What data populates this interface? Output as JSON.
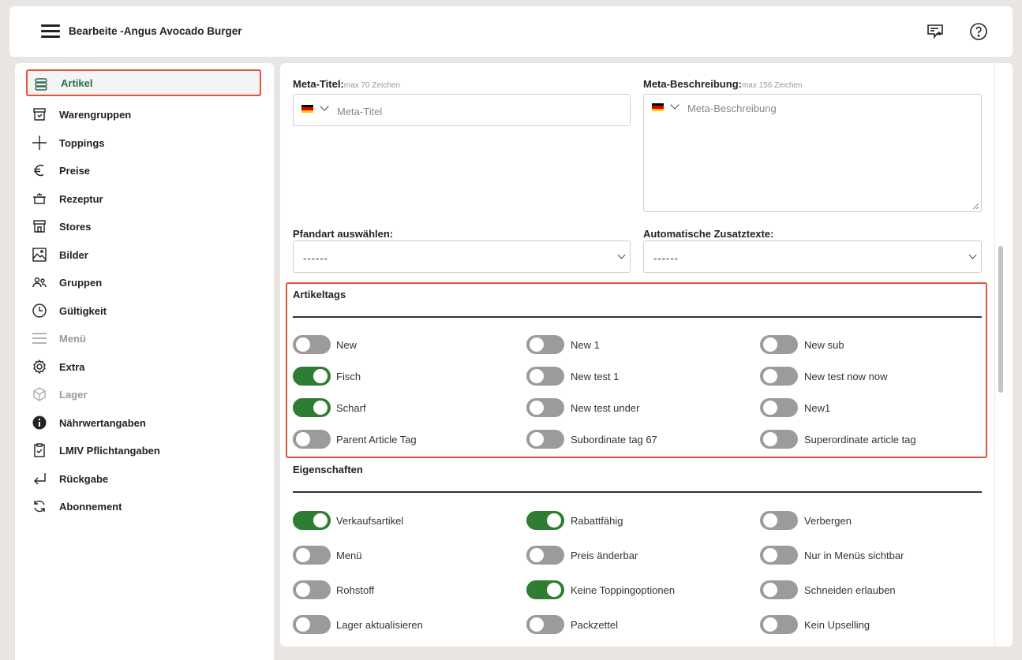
{
  "header": {
    "title": "Bearbeite -Angus Avocado Burger",
    "feedback_icon": "chat-star-icon",
    "help_icon": "help-circle-icon"
  },
  "sidebar": {
    "items": [
      {
        "label": "Artikel",
        "icon": "stack-icon",
        "state": "active"
      },
      {
        "label": "Warengruppen",
        "icon": "box-icon",
        "state": "normal"
      },
      {
        "label": "Toppings",
        "icon": "plus-icon",
        "state": "normal"
      },
      {
        "label": "Preise",
        "icon": "euro-icon",
        "state": "normal"
      },
      {
        "label": "Rezeptur",
        "icon": "pot-icon",
        "state": "normal"
      },
      {
        "label": "Stores",
        "icon": "store-icon",
        "state": "normal"
      },
      {
        "label": "Bilder",
        "icon": "image-icon",
        "state": "normal"
      },
      {
        "label": "Gruppen",
        "icon": "users-icon",
        "state": "normal"
      },
      {
        "label": "Gültigkeit",
        "icon": "clock-icon",
        "state": "normal"
      },
      {
        "label": "Menü",
        "icon": "menu-lines-icon",
        "state": "disabled"
      },
      {
        "label": "Extra",
        "icon": "gear-icon",
        "state": "normal"
      },
      {
        "label": "Lager",
        "icon": "cube-icon",
        "state": "disabled"
      },
      {
        "label": "Nährwertangaben",
        "icon": "info-icon",
        "state": "normal"
      },
      {
        "label": "LMIV Pflichtangaben",
        "icon": "clipboard-check-icon",
        "state": "normal"
      },
      {
        "label": "Rückgabe",
        "icon": "return-arrow-icon",
        "state": "normal"
      },
      {
        "label": "Abonnement",
        "icon": "refresh-icon",
        "state": "normal"
      }
    ]
  },
  "form": {
    "meta_title": {
      "label": "Meta-Titel:",
      "hint": "max 70 Zeichen",
      "placeholder": "Meta-Titel"
    },
    "meta_desc": {
      "label": "Meta-Beschreibung:",
      "hint": "max 156 Zeichen",
      "placeholder": "Meta-Beschreibung"
    },
    "pfandart": {
      "label": "Pfandart auswählen:",
      "value": "------"
    },
    "zusatztexte": {
      "label": "Automatische Zusatztexte:",
      "value": "------"
    }
  },
  "artikeltags": {
    "title": "Artikeltags",
    "items": [
      {
        "label": "New",
        "on": false
      },
      {
        "label": "New 1",
        "on": false
      },
      {
        "label": "New sub",
        "on": false
      },
      {
        "label": "Fisch",
        "on": true
      },
      {
        "label": "New test 1",
        "on": false
      },
      {
        "label": "New test now now",
        "on": false
      },
      {
        "label": "Scharf",
        "on": true
      },
      {
        "label": "New test under",
        "on": false
      },
      {
        "label": "New1",
        "on": false
      },
      {
        "label": "Parent Article Tag",
        "on": false
      },
      {
        "label": "Subordinate tag 67",
        "on": false
      },
      {
        "label": "Superordinate article tag",
        "on": false
      }
    ]
  },
  "eigenschaften": {
    "title": "Eigenschaften",
    "items": [
      {
        "label": "Verkaufsartikel",
        "on": true
      },
      {
        "label": "Rabattfähig",
        "on": true
      },
      {
        "label": "Verbergen",
        "on": false
      },
      {
        "label": "Menü",
        "on": false
      },
      {
        "label": "Preis änderbar",
        "on": false
      },
      {
        "label": "Nur in Menüs sichtbar",
        "on": false
      },
      {
        "label": "Rohstoff",
        "on": false
      },
      {
        "label": "Keine Toppingoptionen",
        "on": true
      },
      {
        "label": "Schneiden erlauben",
        "on": false
      },
      {
        "label": "Lager aktualisieren",
        "on": false
      },
      {
        "label": "Packzettel",
        "on": false
      },
      {
        "label": "Kein Upselling",
        "on": false
      }
    ]
  },
  "colors": {
    "accent": "#2e7d32",
    "highlight": "#e0533d",
    "active_text": "#2e6b4f"
  }
}
